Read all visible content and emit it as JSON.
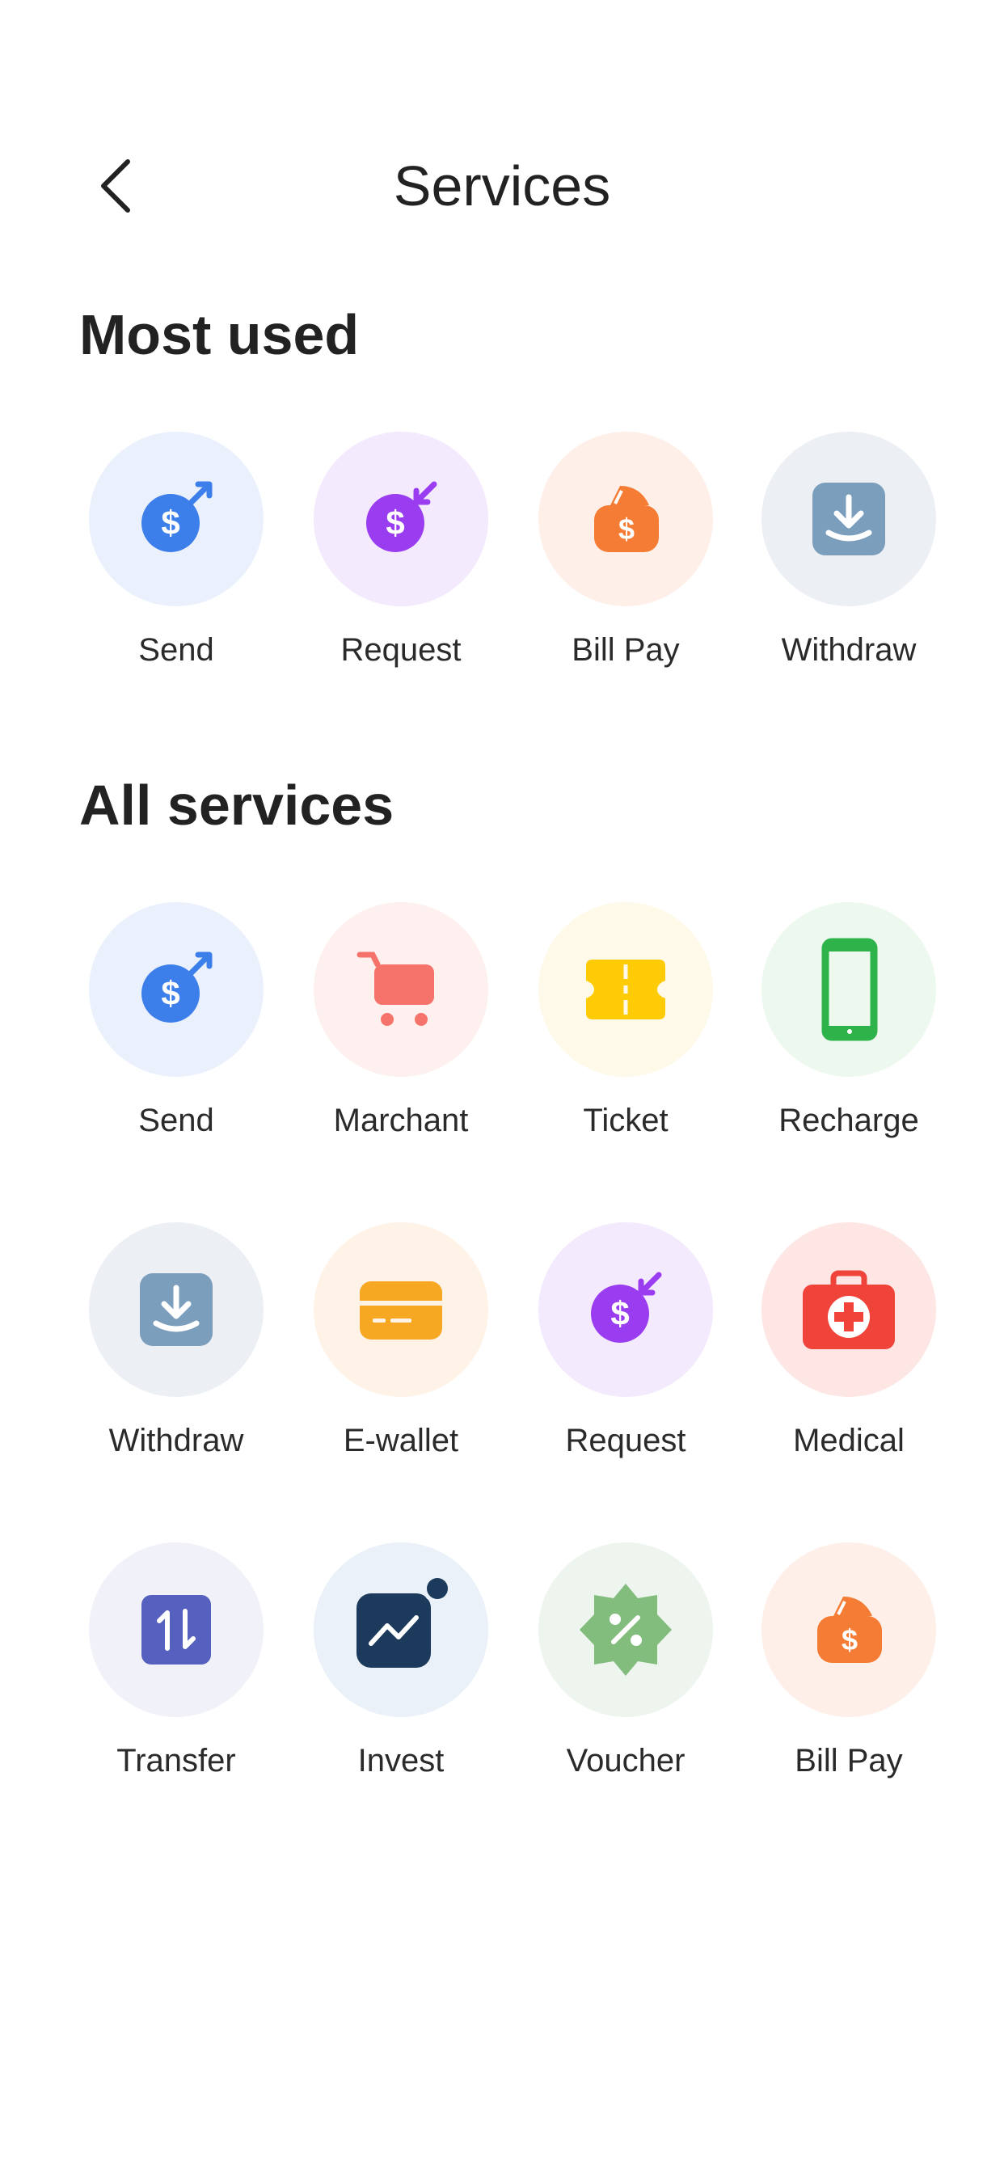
{
  "header": {
    "title": "Services"
  },
  "sections": {
    "most_used": {
      "title": "Most used"
    },
    "all": {
      "title": "All services"
    }
  },
  "most_used": [
    {
      "label": "Send",
      "icon": "send-money-icon",
      "bg": "#EAF1FD",
      "color": "#3D7FEA"
    },
    {
      "label": "Request",
      "icon": "request-money-icon",
      "bg": "#F3EAFD",
      "color": "#9A3CEF"
    },
    {
      "label": "Bill Pay",
      "icon": "bill-pay-icon",
      "bg": "#FEF0E8",
      "color": "#F57C34"
    },
    {
      "label": "Withdraw",
      "icon": "withdraw-icon",
      "bg": "#ECF0F5",
      "color": "#7C9EBD"
    }
  ],
  "all_services": [
    {
      "label": "Send",
      "icon": "send-money-icon",
      "bg": "#EAF1FD",
      "color": "#3D7FEA"
    },
    {
      "label": "Marchant",
      "icon": "shopping-cart-icon",
      "bg": "#FDF0EE",
      "color": "#F5736A"
    },
    {
      "label": "Ticket",
      "icon": "ticket-icon",
      "bg": "#FEF9E8",
      "color": "#FFCB05"
    },
    {
      "label": "Recharge",
      "icon": "mobile-phone-icon",
      "bg": "#EDF8EE",
      "color": "#2DB34A"
    },
    {
      "label": "Withdraw",
      "icon": "withdraw-icon",
      "bg": "#ECF0F5",
      "color": "#7C9EBD"
    },
    {
      "label": "E-wallet",
      "icon": "card-wallet-icon",
      "bg": "#FEF3E6",
      "color": "#F7A823"
    },
    {
      "label": "Request",
      "icon": "request-money-icon",
      "bg": "#F3EAFD",
      "color": "#9A3CEF"
    },
    {
      "label": "Medical",
      "icon": "medical-kit-icon",
      "bg": "#FDE6E4",
      "color": "#F0433A"
    },
    {
      "label": "Transfer",
      "icon": "transfer-arrows-icon",
      "bg": "#F1F2F9",
      "color": "#5560BF"
    },
    {
      "label": "Invest",
      "icon": "invest-chart-icon",
      "bg": "#EAF1F9",
      "color": "#1B3A5C"
    },
    {
      "label": "Voucher",
      "icon": "voucher-discount-icon",
      "bg": "#EEF5EE",
      "color": "#82BD7D"
    },
    {
      "label": "Bill Pay",
      "icon": "bill-pay-icon",
      "bg": "#FEF0E8",
      "color": "#F57C34"
    }
  ]
}
